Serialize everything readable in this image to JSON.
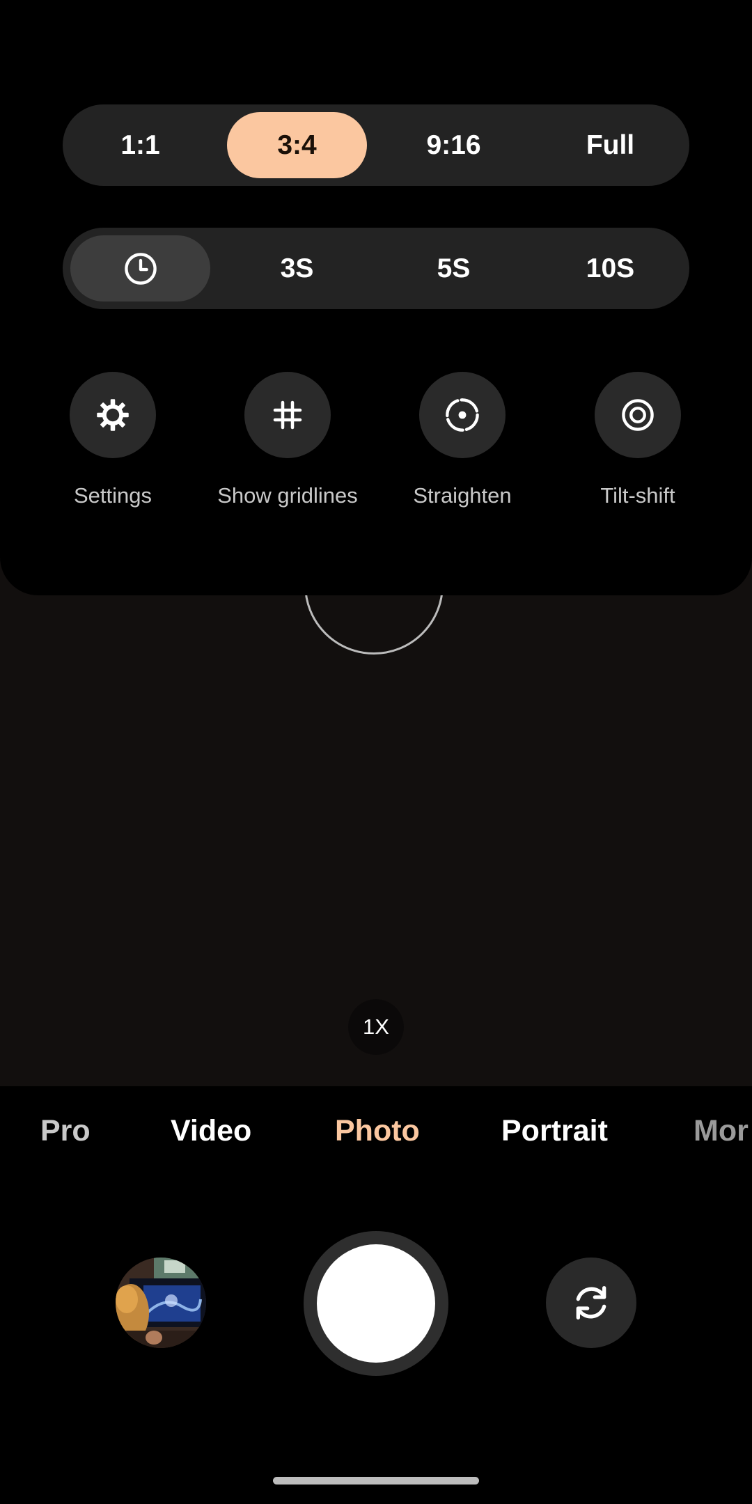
{
  "aspect_ratio": {
    "options": [
      "1:1",
      "3:4",
      "9:16",
      "Full"
    ],
    "selected": "3:4"
  },
  "timer": {
    "options": [
      "clock-icon",
      "3S",
      "5S",
      "10S"
    ],
    "selected": "clock-icon"
  },
  "quick_settings": [
    {
      "label": "Settings",
      "icon": "gear-icon"
    },
    {
      "label": "Show gridlines",
      "icon": "grid-icon"
    },
    {
      "label": "Straighten",
      "icon": "straighten-icon"
    },
    {
      "label": "Tilt-shift",
      "icon": "tilt-shift-icon"
    }
  ],
  "viewfinder": {
    "zoom_label": "1X"
  },
  "modes": {
    "items": [
      "Pro",
      "Video",
      "Photo",
      "Portrait",
      "Mor"
    ],
    "selected": "Photo"
  },
  "colors": {
    "accent": "#fbc7a0",
    "panel": "#000000",
    "segment_bg": "#232323"
  },
  "icons": {
    "flip_camera": "switch-camera-icon",
    "gallery": "gallery-thumbnail"
  }
}
